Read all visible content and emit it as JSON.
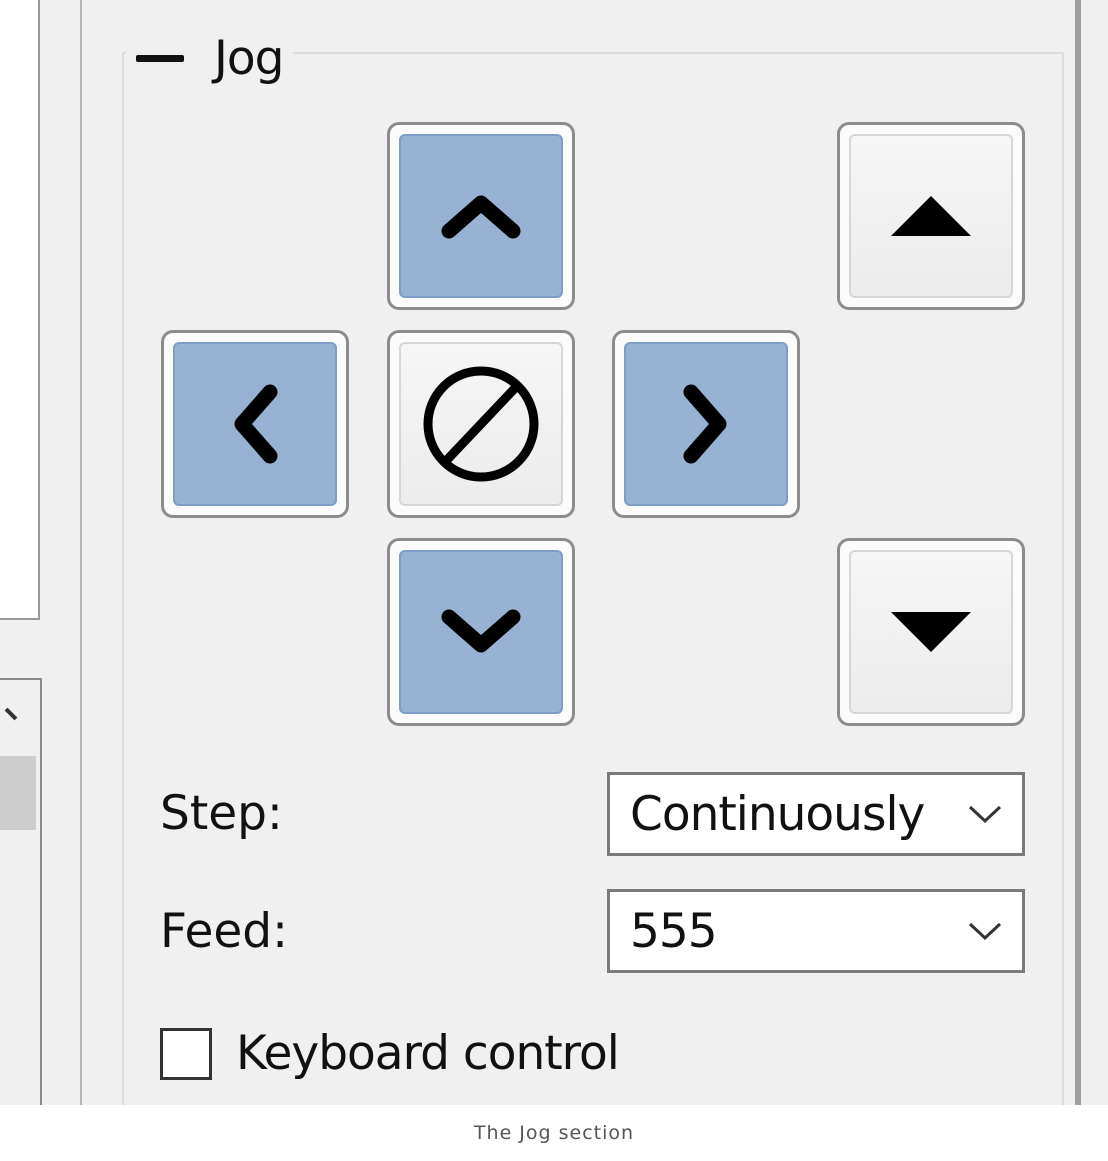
{
  "jog": {
    "title": "Jog",
    "buttons": {
      "y_plus": "chevron-up-icon",
      "x_minus": "chevron-left-icon",
      "stop": "stop-icon",
      "x_plus": "chevron-right-icon",
      "y_minus": "chevron-down-icon",
      "z_plus": "triangle-up-icon",
      "z_minus": "triangle-down-icon"
    },
    "step": {
      "label": "Step:",
      "value": "Continuously"
    },
    "feed": {
      "label": "Feed:",
      "value": "555"
    },
    "keyboard_control": {
      "label": "Keyboard control",
      "checked": false
    }
  },
  "colors": {
    "axis_button": "#97b2d3",
    "panel_background": "#f0f0f0"
  },
  "caption": "The Jog section"
}
